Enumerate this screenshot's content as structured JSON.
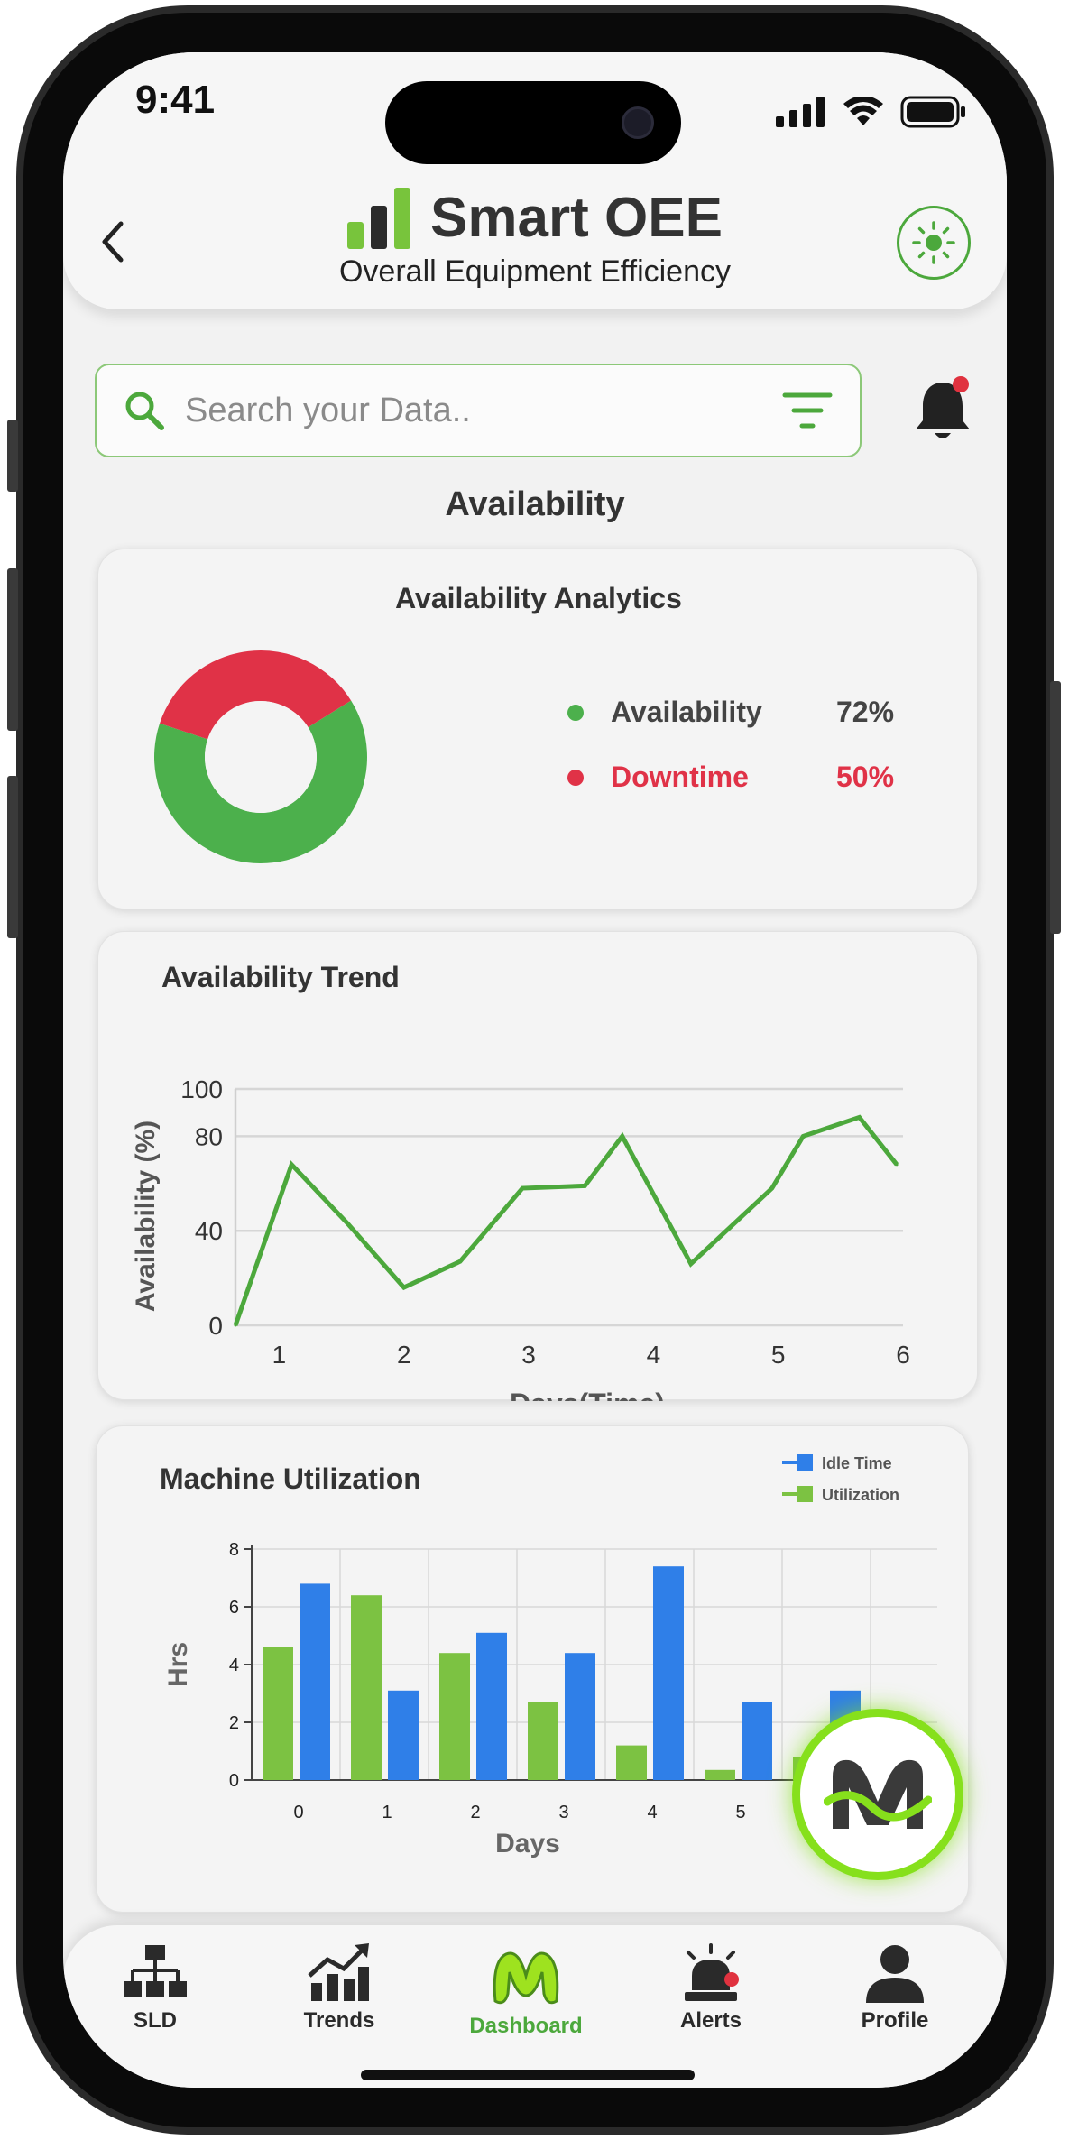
{
  "status": {
    "time": "9:41"
  },
  "header": {
    "title": "Smart OEE",
    "subtitle": "Overall Equipment Efficiency"
  },
  "search": {
    "placeholder": "Search your Data.."
  },
  "section": {
    "title": "Availability"
  },
  "analytics": {
    "title": "Availability Analytics",
    "legend": [
      {
        "label": "Availability",
        "value": "72%",
        "color": "#4cb04c"
      },
      {
        "label": "Downtime",
        "value": "50%",
        "color": "#e03247"
      }
    ]
  },
  "colors": {
    "accent": "#4ca83c",
    "downtime": "#e03247",
    "idle": "#2f7fe8",
    "utilization": "#7cc242"
  },
  "chart_data": [
    {
      "type": "pie",
      "title": "Availability Analytics",
      "categories": [
        "Availability",
        "Downtime"
      ],
      "values": [
        64,
        36
      ],
      "labels": [
        "72%",
        "50%"
      ],
      "donut": true
    },
    {
      "type": "line",
      "title": "Availability Trend",
      "xlabel": "Days(Time)",
      "ylabel": "Availability (%)",
      "xlim": [
        0.65,
        6
      ],
      "ylim": [
        0,
        100
      ],
      "xticks": [
        "1",
        "2",
        "3",
        "4",
        "5",
        "6"
      ],
      "yticks": [
        "0",
        "40",
        "80",
        "100"
      ],
      "grid": true,
      "series": [
        {
          "x": [
            0.65,
            1.1,
            1.55,
            2.0,
            2.45,
            2.95,
            3.45,
            3.75,
            4.3,
            4.95,
            5.2,
            5.65,
            5.95
          ],
          "y": [
            0,
            68,
            43,
            16,
            27,
            58,
            59,
            80,
            26,
            58,
            80,
            88,
            68
          ],
          "color": "#4ca83c"
        }
      ]
    },
    {
      "type": "bar",
      "title": "Machine Utilization",
      "xlabel": "Days",
      "ylabel": "Hrs",
      "categories": [
        "0",
        "1",
        "2",
        "3",
        "4",
        "5",
        "6"
      ],
      "xticks": [
        "0",
        "1",
        "2",
        "3",
        "4",
        "5"
      ],
      "yticks": [
        "0",
        "2",
        "4",
        "6",
        "8"
      ],
      "ylim": [
        0,
        8
      ],
      "legend_position": "top-right",
      "grid": true,
      "series": [
        {
          "name": "Utilization",
          "values": [
            4.6,
            6.4,
            4.4,
            2.7,
            1.2,
            0.35,
            0.8
          ],
          "color": "#7cc242"
        },
        {
          "name": "Idle Time",
          "values": [
            6.8,
            3.1,
            5.1,
            4.4,
            7.4,
            2.7,
            3.1
          ],
          "color": "#2f7fe8"
        }
      ]
    }
  ],
  "nav": [
    {
      "label": "SLD",
      "icon": "sitemap-icon"
    },
    {
      "label": "Trends",
      "icon": "trend-chart-icon"
    },
    {
      "label": "Dashboard",
      "icon": "dashboard-logo-icon",
      "active": true
    },
    {
      "label": "Alerts",
      "icon": "siren-icon"
    },
    {
      "label": "Profile",
      "icon": "user-icon"
    }
  ]
}
